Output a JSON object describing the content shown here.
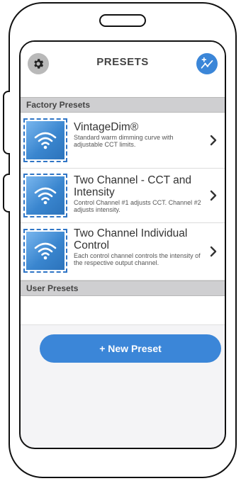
{
  "header": {
    "title": "PRESETS"
  },
  "icons": {
    "settings": "gear-icon",
    "add": "add-chart-icon"
  },
  "factory_presets": {
    "heading": "Factory Presets",
    "items": [
      {
        "title": "VintageDim®",
        "description": "Standard warm dimming curve with adjustable CCT limits."
      },
      {
        "title": "Two Channel - CCT and Intensity",
        "description": "Control Channel #1 adjusts CCT. Channel #2 adjusts intensity."
      },
      {
        "title": "Two Channel Individual Control",
        "description": "Each control channel controls the intensity of the respective output channel."
      }
    ]
  },
  "user_presets": {
    "heading": "User Presets"
  },
  "new_preset_button": {
    "label": "+ New Preset"
  },
  "colors": {
    "accent": "#3b86d8",
    "section_bg": "#cfcfd1"
  }
}
